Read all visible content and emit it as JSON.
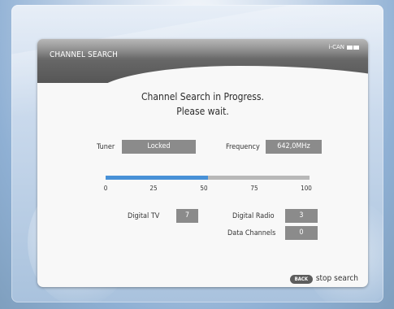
{
  "screen": {
    "title": "CHANNEL SEARCH",
    "brand": "i-CAN",
    "message_line_1": "Channel Search in Progress.",
    "message_line_2": "Please wait."
  },
  "status": {
    "tuner_label": "Tuner",
    "tuner_value": "Locked",
    "frequency_label": "Frequency",
    "frequency_value": "642,0MHz"
  },
  "progress": {
    "value": 50,
    "max": 100,
    "ticks": [
      "0",
      "25",
      "50",
      "75",
      "100"
    ]
  },
  "counts": {
    "digital_tv_label": "Digital TV",
    "digital_tv_value": "7",
    "digital_radio_label": "Digital Radio",
    "digital_radio_value": "3",
    "data_channels_label": "Data Channels",
    "data_channels_value": "0"
  },
  "footer": {
    "back_button": "BACK",
    "stop_search": "stop search"
  },
  "colors": {
    "progress_fill": "#4891d7",
    "progress_track": "#b8b8b8",
    "value_box": "#8b8b8b",
    "dialog_bg": "#f8f8f8",
    "header_dark": "#565656"
  },
  "icons": {
    "sparkle": "sparkle-icon",
    "brand_boxes": "brand-boxes-icon"
  }
}
